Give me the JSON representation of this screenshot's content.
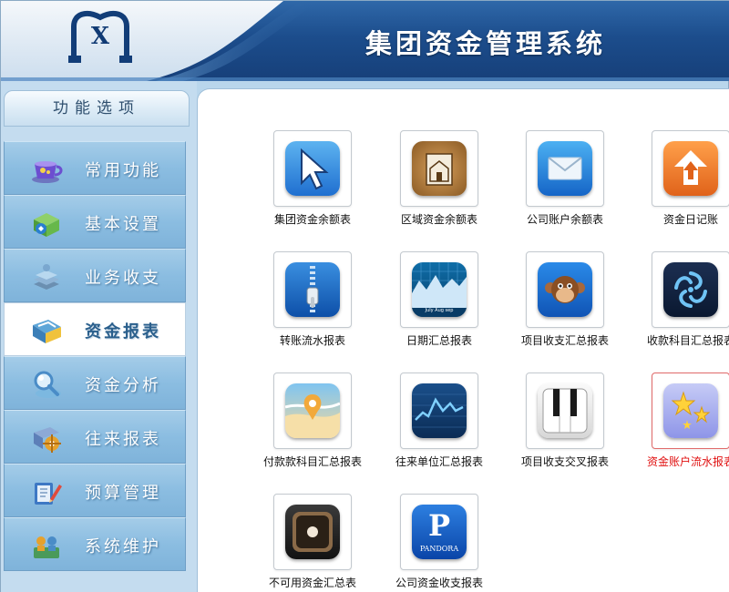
{
  "header": {
    "logo_letter": "X",
    "title": "集团资金管理系统"
  },
  "sidebar": {
    "heading": "功能选项",
    "items": [
      {
        "label": "常用功能",
        "icon": "teacup-icon"
      },
      {
        "label": "基本设置",
        "icon": "settings-cube-icon"
      },
      {
        "label": "业务收支",
        "icon": "stack-layers-icon"
      },
      {
        "label": "资金报表",
        "icon": "report-folder-icon",
        "active": true
      },
      {
        "label": "资金分析",
        "icon": "magnifier-icon"
      },
      {
        "label": "往来报表",
        "icon": "compass-wheel-icon"
      },
      {
        "label": "预算管理",
        "icon": "pencil-notebook-icon"
      },
      {
        "label": "系统维护",
        "icon": "tools-people-icon"
      }
    ]
  },
  "reports": [
    {
      "label": "集团资金余额表",
      "icon": "cursor-arrow-icon"
    },
    {
      "label": "区域资金余额表",
      "icon": "house-frame-icon"
    },
    {
      "label": "公司账户余额表",
      "icon": "envelope-icon"
    },
    {
      "label": "资金日记账",
      "icon": "house-up-icon"
    },
    {
      "label": "转账流水报表",
      "icon": "zipper-icon"
    },
    {
      "label": "日期汇总报表",
      "icon": "calendar-chart-icon",
      "months": "July Aug sep"
    },
    {
      "label": "项目收支汇总报表",
      "icon": "monkey-icon"
    },
    {
      "label": "收款科目汇总报表",
      "icon": "spiral-icon"
    },
    {
      "label": "付款款科目汇总报表",
      "icon": "map-pin-icon"
    },
    {
      "label": "往来单位汇总报表",
      "icon": "stock-chart-icon"
    },
    {
      "label": "项目收支交叉报表",
      "icon": "piano-keys-icon"
    },
    {
      "label": "资金账户流水报表",
      "icon": "stars-icon",
      "highlighted": true
    },
    {
      "label": "不可用资金汇总表",
      "icon": "dark-disc-icon"
    },
    {
      "label": "公司资金收支报表",
      "icon": "pandora-p-icon",
      "brand": "PANDORA",
      "letter": "P"
    }
  ],
  "colors": {
    "header_blue": "#1c4d8c",
    "menu_blue": "#8bbde1",
    "highlight_label": "#e01010"
  }
}
